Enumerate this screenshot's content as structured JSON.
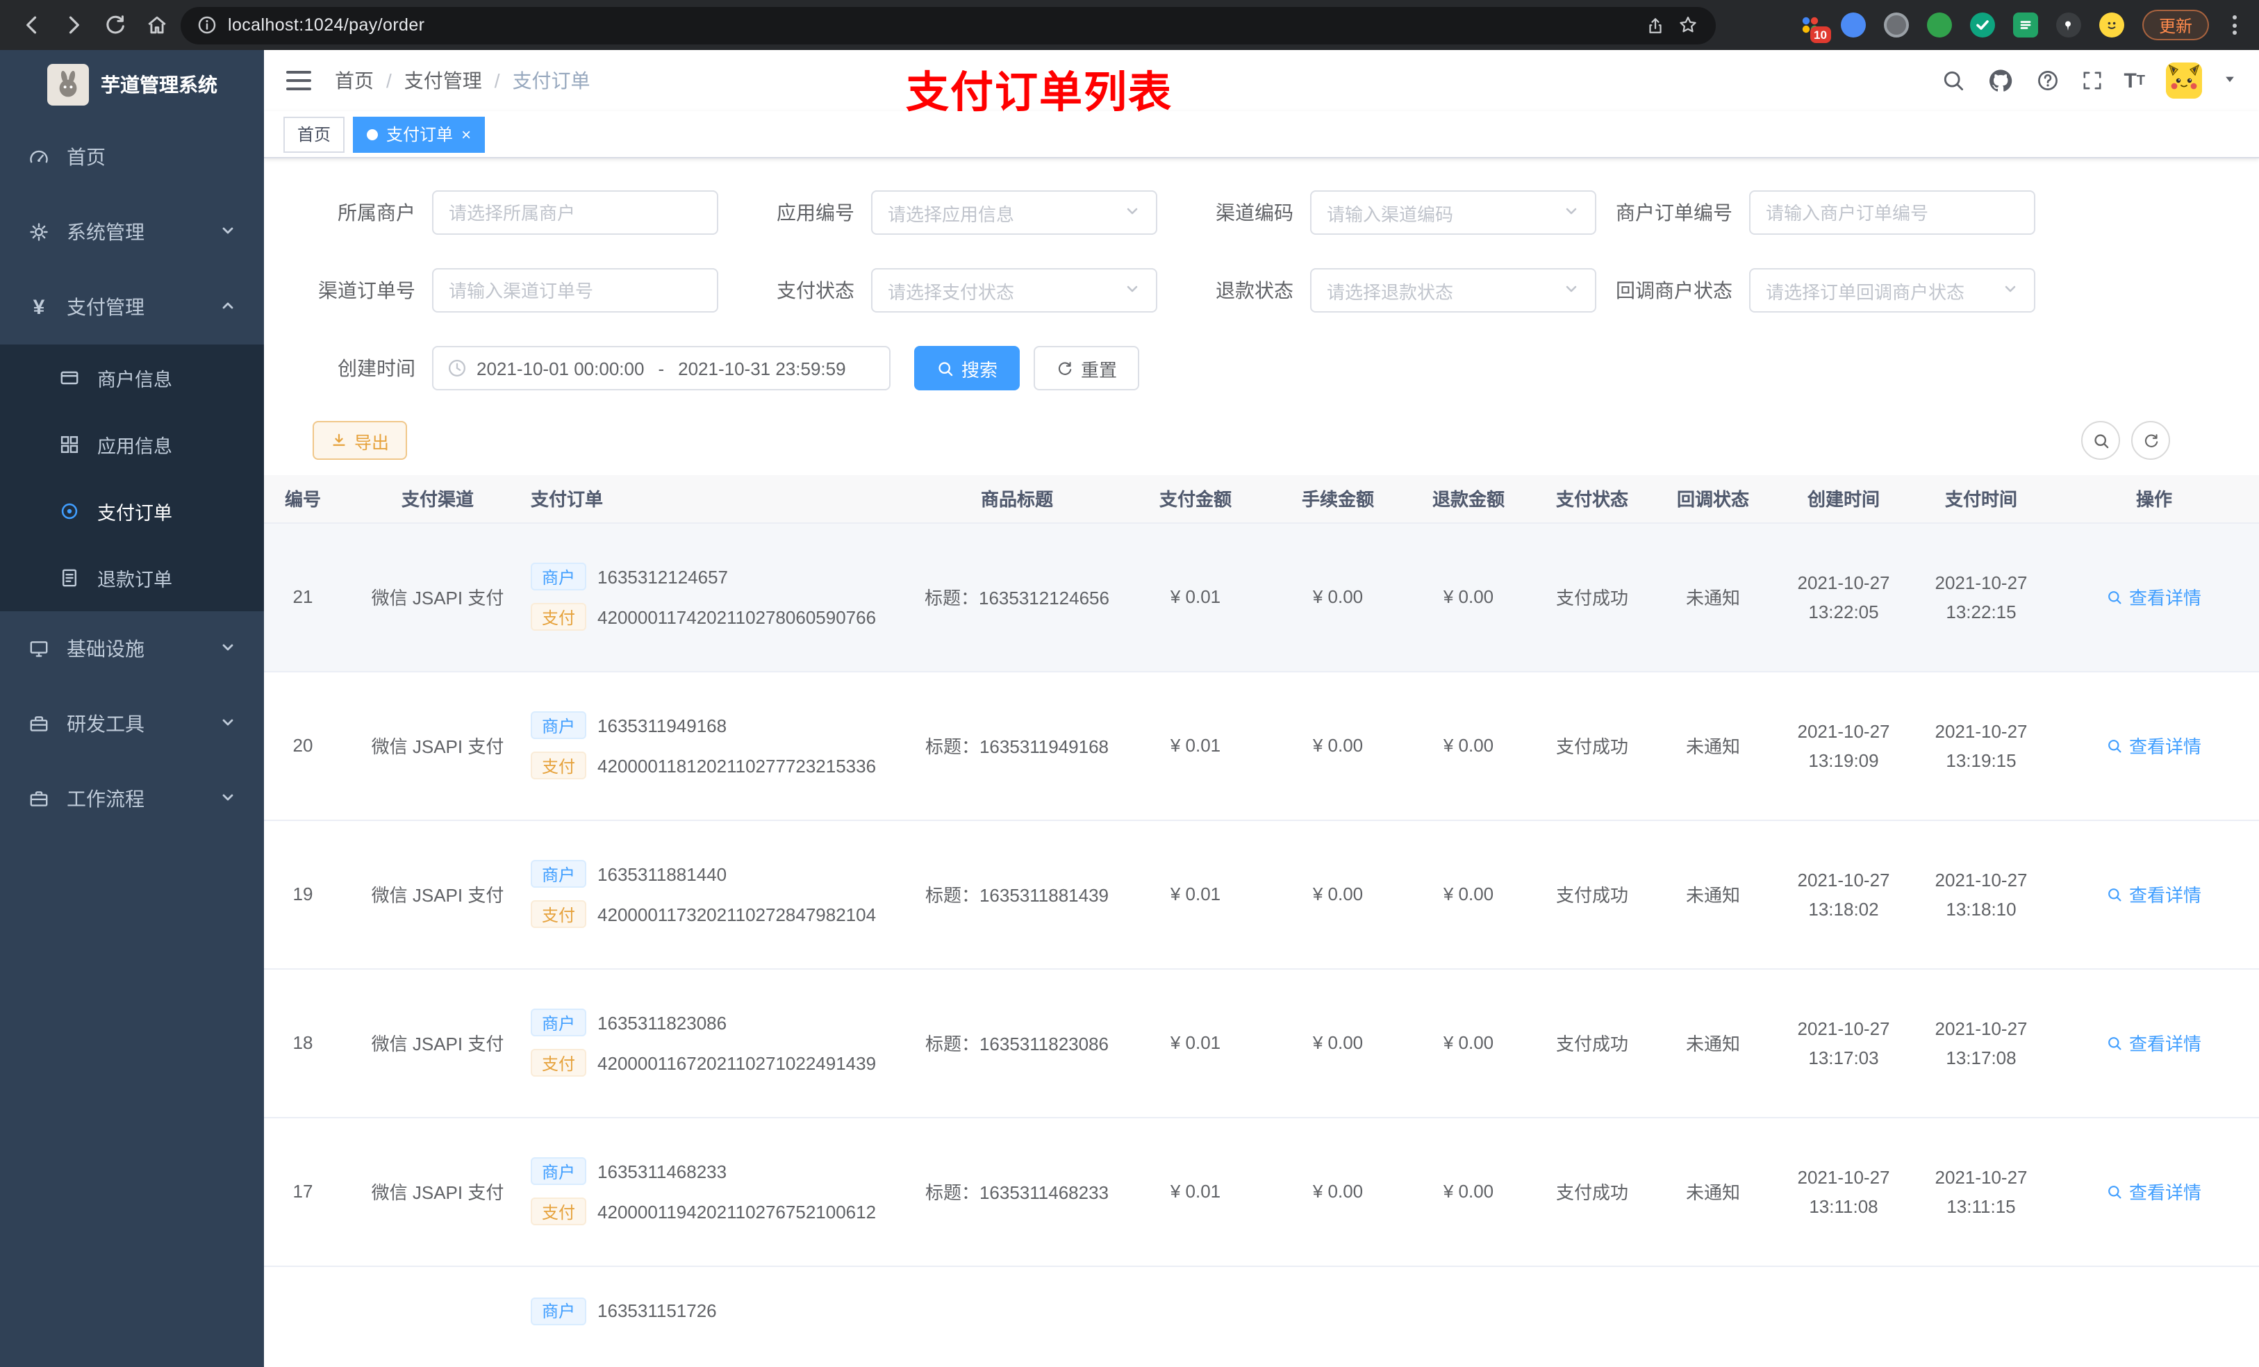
{
  "browser": {
    "url": "localhost:1024/pay/order",
    "update_label": "更新",
    "ext_badge": "10"
  },
  "sidebar": {
    "title": "芋道管理系统",
    "home": "首页",
    "system": "系统管理",
    "pay": "支付管理",
    "sub_merchant": "商户信息",
    "sub_app": "应用信息",
    "sub_order": "支付订单",
    "sub_refund": "退款订单",
    "infra": "基础设施",
    "devtools": "研发工具",
    "workflow": "工作流程"
  },
  "breadcrumb": {
    "home": "首页",
    "section": "支付管理",
    "current": "支付订单"
  },
  "header": {
    "annotation": "支付订单列表"
  },
  "tabs": {
    "home": "首页",
    "current": "支付订单"
  },
  "filters": {
    "merchant": {
      "label": "所属商户",
      "placeholder": "请选择所属商户"
    },
    "app": {
      "label": "应用编号",
      "placeholder": "请选择应用信息"
    },
    "channel_code": {
      "label": "渠道编码",
      "placeholder": "请输入渠道编码"
    },
    "merchant_order_no": {
      "label": "商户订单编号",
      "placeholder": "请输入商户订单编号"
    },
    "channel_order_no": {
      "label": "渠道订单号",
      "placeholder": "请输入渠道订单号"
    },
    "pay_status": {
      "label": "支付状态",
      "placeholder": "请选择支付状态"
    },
    "refund_status": {
      "label": "退款状态",
      "placeholder": "请选择退款状态"
    },
    "notify_status": {
      "label": "回调商户状态",
      "placeholder": "请选择订单回调商户状态"
    },
    "create_time": {
      "label": "创建时间",
      "start": "2021-10-01 00:00:00",
      "separator": "-",
      "end": "2021-10-31 23:59:59"
    },
    "search": "搜索",
    "reset": "重置"
  },
  "toolbar": {
    "export": "导出"
  },
  "table": {
    "columns": {
      "id": "编号",
      "channel": "支付渠道",
      "order": "支付订单",
      "title": "商品标题",
      "amount": "支付金额",
      "fee": "手续金额",
      "refund": "退款金额",
      "status": "支付状态",
      "notify": "回调状态",
      "create": "创建时间",
      "pay_time": "支付时间",
      "action": "操作"
    },
    "badge_merchant": "商户",
    "badge_pay": "支付",
    "rows": [
      {
        "id": "21",
        "channel": "微信 JSAPI 支付",
        "merchant_no": "1635312124657",
        "pay_no": "4200001174202110278060590766",
        "title": "标题：1635312124656",
        "amount": "¥ 0.01",
        "fee": "¥ 0.00",
        "refund": "¥ 0.00",
        "status": "支付成功",
        "notify": "未通知",
        "create_date": "2021-10-27",
        "create_time": "13:22:05",
        "pay_date": "2021-10-27",
        "pay_time": "13:22:15",
        "action": "查看详情"
      },
      {
        "id": "20",
        "channel": "微信 JSAPI 支付",
        "merchant_no": "1635311949168",
        "pay_no": "4200001181202110277723215336",
        "title": "标题：1635311949168",
        "amount": "¥ 0.01",
        "fee": "¥ 0.00",
        "refund": "¥ 0.00",
        "status": "支付成功",
        "notify": "未通知",
        "create_date": "2021-10-27",
        "create_time": "13:19:09",
        "pay_date": "2021-10-27",
        "pay_time": "13:19:15",
        "action": "查看详情"
      },
      {
        "id": "19",
        "channel": "微信 JSAPI 支付",
        "merchant_no": "1635311881440",
        "pay_no": "4200001173202110272847982104",
        "title": "标题：1635311881439",
        "amount": "¥ 0.01",
        "fee": "¥ 0.00",
        "refund": "¥ 0.00",
        "status": "支付成功",
        "notify": "未通知",
        "create_date": "2021-10-27",
        "create_time": "13:18:02",
        "pay_date": "2021-10-27",
        "pay_time": "13:18:10",
        "action": "查看详情"
      },
      {
        "id": "18",
        "channel": "微信 JSAPI 支付",
        "merchant_no": "1635311823086",
        "pay_no": "4200001167202110271022491439",
        "title": "标题：1635311823086",
        "amount": "¥ 0.01",
        "fee": "¥ 0.00",
        "refund": "¥ 0.00",
        "status": "支付成功",
        "notify": "未通知",
        "create_date": "2021-10-27",
        "create_time": "13:17:03",
        "pay_date": "2021-10-27",
        "pay_time": "13:17:08",
        "action": "查看详情"
      },
      {
        "id": "17",
        "channel": "微信 JSAPI 支付",
        "merchant_no": "1635311468233",
        "pay_no": "4200001194202110276752100612",
        "title": "标题：1635311468233",
        "amount": "¥ 0.01",
        "fee": "¥ 0.00",
        "refund": "¥ 0.00",
        "status": "支付成功",
        "notify": "未通知",
        "create_date": "2021-10-27",
        "create_time": "13:11:08",
        "pay_date": "2021-10-27",
        "pay_time": "13:11:15",
        "action": "查看详情"
      }
    ],
    "partial": {
      "merchant_no": "163531151726"
    }
  }
}
